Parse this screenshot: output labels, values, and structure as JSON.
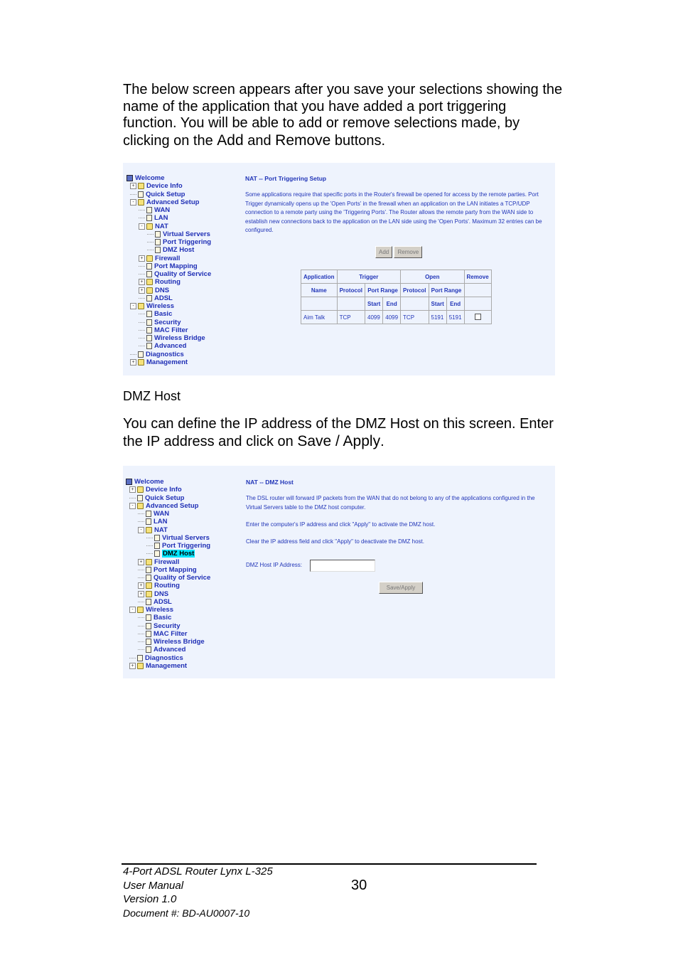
{
  "intro": {
    "text1": "The below screen appears after you save your selections showing the name of the application that you have added a port triggering function.  You will be able to add or remove selections made, by clicking on the ",
    "add": "Add",
    "and": " and ",
    "remove": "Remove",
    "text2": " buttons."
  },
  "tree": [
    {
      "label": "Welcome",
      "level": 0,
      "icon": "computer",
      "exp": ""
    },
    {
      "label": "Device Info",
      "level": 1,
      "icon": "folder",
      "exp": "+"
    },
    {
      "label": "Quick Setup",
      "level": 1,
      "icon": "page",
      "exp": ""
    },
    {
      "label": "Advanced Setup",
      "level": 1,
      "icon": "folder-open",
      "exp": "-"
    },
    {
      "label": "WAN",
      "level": 2,
      "icon": "page",
      "exp": ""
    },
    {
      "label": "LAN",
      "level": 2,
      "icon": "page",
      "exp": ""
    },
    {
      "label": "NAT",
      "level": 2,
      "icon": "folder-open",
      "exp": "-"
    },
    {
      "label": "Virtual Servers",
      "level": 3,
      "icon": "page",
      "exp": ""
    },
    {
      "label": "Port Triggering",
      "level": 3,
      "icon": "page",
      "exp": ""
    },
    {
      "label": "DMZ Host",
      "level": 3,
      "icon": "page",
      "exp": ""
    },
    {
      "label": "Firewall",
      "level": 2,
      "icon": "folder",
      "exp": "+"
    },
    {
      "label": "Port Mapping",
      "level": 2,
      "icon": "page",
      "exp": ""
    },
    {
      "label": "Quality of Service",
      "level": 2,
      "icon": "page",
      "exp": ""
    },
    {
      "label": "Routing",
      "level": 2,
      "icon": "folder",
      "exp": "+"
    },
    {
      "label": "DNS",
      "level": 2,
      "icon": "folder",
      "exp": "+"
    },
    {
      "label": "ADSL",
      "level": 2,
      "icon": "page",
      "exp": ""
    },
    {
      "label": "Wireless",
      "level": 1,
      "icon": "folder-open",
      "exp": "-"
    },
    {
      "label": "Basic",
      "level": 2,
      "icon": "page",
      "exp": ""
    },
    {
      "label": "Security",
      "level": 2,
      "icon": "page",
      "exp": ""
    },
    {
      "label": "MAC Filter",
      "level": 2,
      "icon": "page",
      "exp": ""
    },
    {
      "label": "Wireless Bridge",
      "level": 2,
      "icon": "page",
      "exp": ""
    },
    {
      "label": "Advanced",
      "level": 2,
      "icon": "page",
      "exp": ""
    },
    {
      "label": "Diagnostics",
      "level": 1,
      "icon": "page",
      "exp": ""
    },
    {
      "label": "Management",
      "level": 1,
      "icon": "folder",
      "exp": "+"
    }
  ],
  "shot1": {
    "title": "NAT -- Port Triggering Setup",
    "desc": "Some applications require that specific ports in the Router's firewall be opened for access by the remote parties. Port Trigger dynamically opens up the 'Open Ports' in the firewall when an application on the LAN initiates a TCP/UDP connection to a remote party using the 'Triggering Ports'. The Router allows the remote party from the WAN side to establish new connections back to the application on the LAN side using the 'Open Ports'. Maximum 32 entries can be configured.",
    "add_label": "Add",
    "remove_label": "Remove",
    "headers": {
      "application": "Application",
      "trigger": "Trigger",
      "open": "Open",
      "remove": "Remove",
      "name": "Name",
      "protocol": "Protocol",
      "port_range": "Port Range",
      "start": "Start",
      "end": "End"
    },
    "rows": [
      {
        "name": "Aim Talk",
        "trigger_protocol": "TCP",
        "trigger_start": "4099",
        "trigger_end": "4099",
        "open_protocol": "TCP",
        "open_start": "5191",
        "open_end": "5191",
        "remove_checked": false
      }
    ]
  },
  "dmz_heading": "DMZ Host",
  "dmz_intro": {
    "text1": "You can define the IP address of the DMZ Host on this screen. Enter the IP address and click on ",
    "save": "Save / Apply",
    "text2": "."
  },
  "shot2": {
    "selected": "DMZ Host",
    "title": "NAT -- DMZ Host",
    "desc1": "The DSL router will forward IP packets from the WAN that do not belong to any of the applications configured in the Virtual Servers table to the DMZ host computer.",
    "desc2": "Enter the computer's IP address and click \"Apply\" to activate the DMZ host.",
    "desc3": "Clear the IP address field and click \"Apply\" to deactivate the DMZ host.",
    "ip_label": "DMZ Host IP Address:",
    "ip_value": "",
    "save_label": "Save/Apply"
  },
  "footer": {
    "line1": "4-Port ADSL Router Lynx L-325",
    "line2": "User Manual",
    "line3": "Version 1.0",
    "line4": "Document #:  BD-AU0007-10",
    "page_number": "30"
  }
}
